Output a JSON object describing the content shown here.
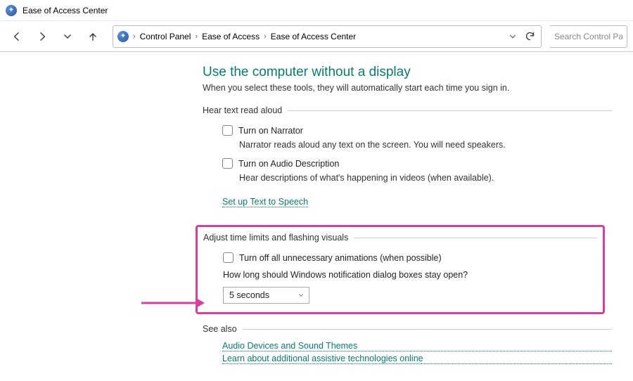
{
  "window": {
    "title": "Ease of Access Center"
  },
  "breadcrumb": {
    "items": [
      "Control Panel",
      "Ease of Access",
      "Ease of Access Center"
    ]
  },
  "search": {
    "placeholder": "Search Control Pan"
  },
  "page": {
    "heading": "Use the computer without a display",
    "subheading": "When you select these tools, they will automatically start each time you sign in."
  },
  "section_hear": {
    "legend": "Hear text read aloud",
    "narrator_label": "Turn on Narrator",
    "narrator_desc": "Narrator reads aloud any text on the screen. You will need speakers.",
    "audio_label": "Turn on Audio Description",
    "audio_desc": "Hear descriptions of what's happening in videos (when available).",
    "tts_link": "Set up Text to Speech"
  },
  "section_adjust": {
    "legend": "Adjust time limits and flashing visuals",
    "anim_label": "Turn off all unnecessary animations (when possible)",
    "notif_question": "How long should Windows notification dialog boxes stay open?",
    "notif_value": "5 seconds"
  },
  "section_seealso": {
    "legend": "See also",
    "link1": "Audio Devices and Sound Themes",
    "link2": "Learn about additional assistive technologies online"
  }
}
